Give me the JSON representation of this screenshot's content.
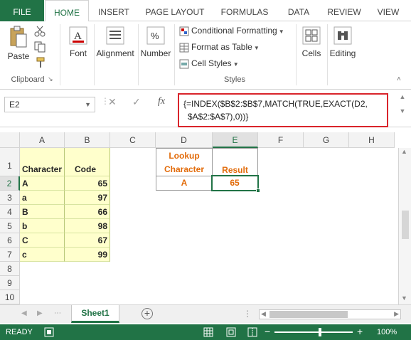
{
  "ribbon_tabs": [
    "FILE",
    "HOME",
    "INSERT",
    "PAGE LAYOUT",
    "FORMULAS",
    "DATA",
    "REVIEW",
    "VIEW"
  ],
  "ribbon": {
    "clipboard": {
      "paste_label": "Paste",
      "group_label": "Clipboard"
    },
    "font_label": "Font",
    "alignment_label": "Alignment",
    "number_label": "Number",
    "number_icon": "%",
    "styles": {
      "conditional_formatting": "Conditional Formatting",
      "format_as_table": "Format as Table",
      "cell_styles": "Cell Styles",
      "group_label": "Styles"
    },
    "cells_label": "Cells",
    "editing_label": "Editing"
  },
  "formula_bar": {
    "name_box": "E2",
    "fx_label": "fx",
    "formula_line1": "{=INDEX($B$2:$B$7,MATCH(TRUE,EXACT(D2,",
    "formula_line2": "$A$2:$A$7),0))}"
  },
  "columns": [
    "A",
    "B",
    "C",
    "D",
    "E",
    "F",
    "G",
    "H"
  ],
  "rows": [
    "1",
    "2",
    "3",
    "4",
    "5",
    "6",
    "7",
    "8",
    "9",
    "10"
  ],
  "table": {
    "headers": [
      "Character",
      "Code"
    ],
    "rows": [
      [
        "A",
        "65"
      ],
      [
        "a",
        "97"
      ],
      [
        "B",
        "66"
      ],
      [
        "b",
        "98"
      ],
      [
        "C",
        "67"
      ],
      [
        "c",
        "99"
      ]
    ]
  },
  "lookup": {
    "header_d_line1": "Lookup",
    "header_d_line2": "Character",
    "header_e": "Result",
    "d2": "A",
    "e2": "65"
  },
  "sheet_tab": "Sheet1",
  "add_sheet_icon": "+",
  "status": {
    "ready": "READY",
    "zoom": "100%"
  },
  "colors": {
    "excel_green": "#217346",
    "highlight_red": "#d9242b",
    "cell_yellow": "#ffffcc",
    "accent_orange": "#e26b0a"
  }
}
